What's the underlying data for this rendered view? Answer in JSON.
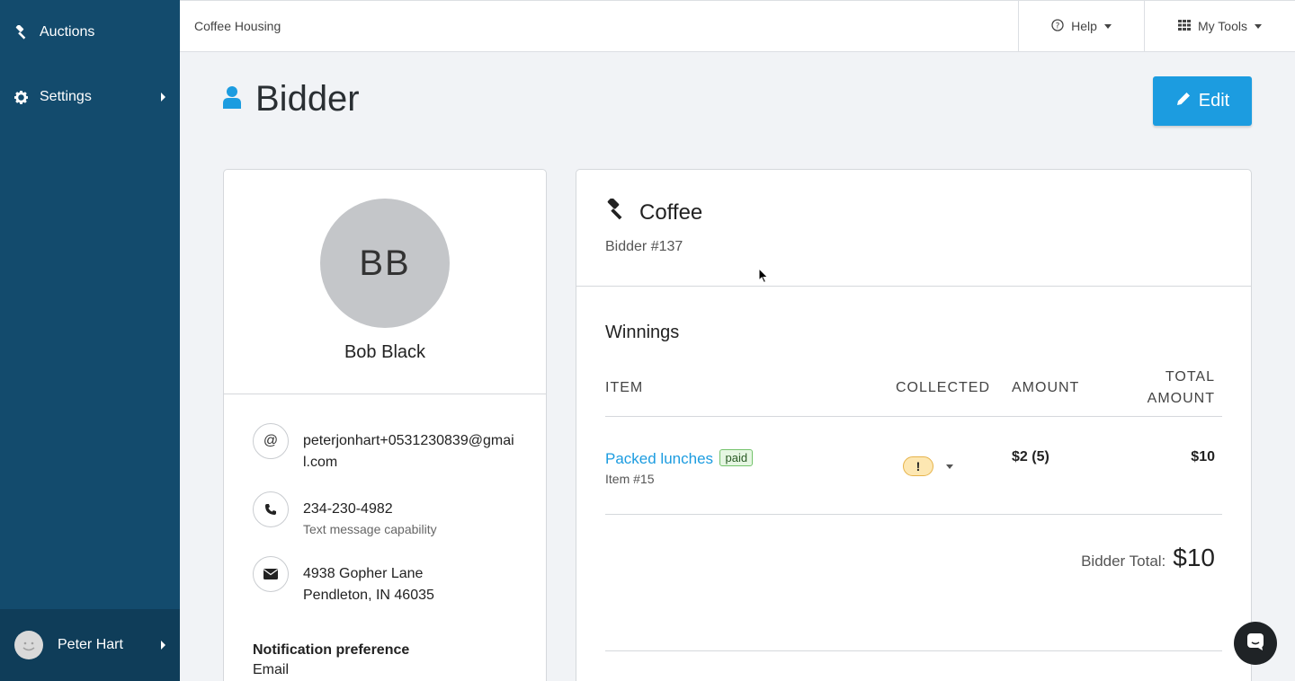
{
  "sidebar": {
    "items": [
      {
        "label": "Auctions",
        "icon": "gavel-icon"
      },
      {
        "label": "Settings",
        "icon": "gear-icon"
      }
    ],
    "user": {
      "name": "Peter Hart"
    }
  },
  "topbar": {
    "org_name": "Coffee Housing",
    "help_label": "Help",
    "tools_label": "My Tools"
  },
  "header": {
    "title": "Bidder",
    "edit_label": "Edit"
  },
  "profile": {
    "initials": "BB",
    "name": "Bob Black",
    "email": "peterjonhart+0531230839@gmail.com",
    "phone": "234-230-4982",
    "phone_note": "Text message capability",
    "address_line1": "4938 Gopher Lane",
    "address_line2": "Pendleton, IN 46035",
    "notification_label": "Notification preference",
    "notification_value": "Email"
  },
  "auction": {
    "name": "Coffee",
    "bidder_number": "Bidder #137"
  },
  "winnings": {
    "title": "Winnings",
    "columns": {
      "item": "ITEM",
      "collected": "COLLECTED",
      "amount": "AMOUNT",
      "total_line1": "TOTAL",
      "total_line2": "AMOUNT"
    },
    "rows": [
      {
        "item_name": "Packed lunches",
        "badge": "paid",
        "item_number": "Item #15",
        "collected_status": "!",
        "amount": "$2 (5)",
        "total": "$10"
      }
    ],
    "bidder_total_label": "Bidder Total:",
    "bidder_total_value": "$10"
  },
  "colors": {
    "sidebar": "#134b6d",
    "accent": "#1c9ce0",
    "paid_badge": "#e5f6e2",
    "warning": "#fde7b2"
  }
}
